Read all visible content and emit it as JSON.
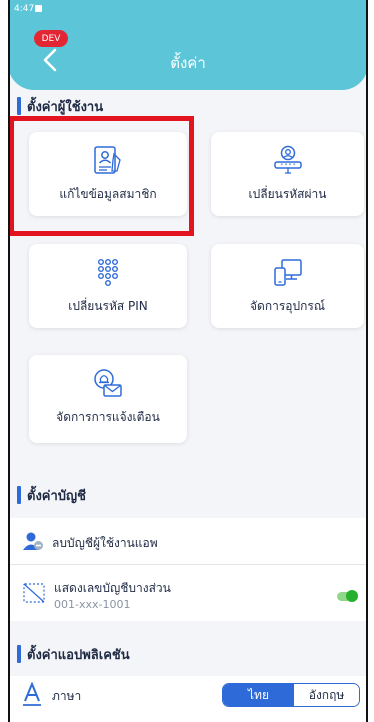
{
  "status": {
    "time": "4:47"
  },
  "header": {
    "dev_badge": "DEV",
    "title": "ตั้งค่า"
  },
  "sections": {
    "user": "ตั้งค่าผู้ใช้งาน",
    "account": "ตั้งค่าบัญชี",
    "app": "ตั้งค่าแอปพลิเคชัน"
  },
  "cards": {
    "edit_member": "แก้ไขข้อมูลสมาชิก",
    "change_password": "เปลี่ยนรหัสผ่าน",
    "change_pin": "เปลี่ยนรหัส PIN",
    "manage_devices": "จัดการอุปกรณ์",
    "manage_notifications": "จัดการการแจ้งเตือน"
  },
  "account": {
    "delete_user": "ลบบัญชีผู้ใช้งานแอพ",
    "partial_number": "แสดงเลขบัญชีบางส่วน",
    "account_number": "001-xxx-1001",
    "partial_toggle_on": true
  },
  "app": {
    "language_label": "ภาษา",
    "lang_thai": "ไทย",
    "lang_english": "อังกฤษ",
    "selected": "ไทย"
  },
  "colors": {
    "header": "#5cc6d8",
    "accent": "#2f6bd8",
    "highlight": "#e3131f",
    "toggle": "#27b02d"
  }
}
